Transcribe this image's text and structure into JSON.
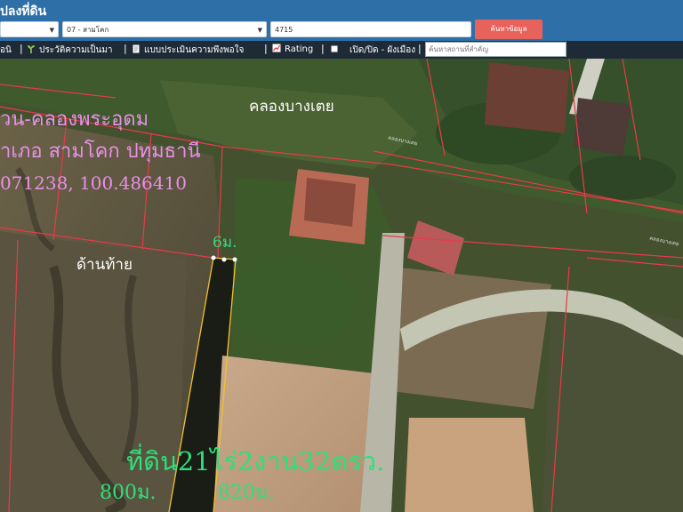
{
  "header": {
    "title": "ปลงที่ดิน",
    "district_select": "07 - สามโคก",
    "parcel_input": "4715",
    "search_button": "ค้นหาข้อมูล"
  },
  "toolbar": {
    "item_first": "อนิ",
    "history": "ประวัติความเป็นมา",
    "survey": "แบบประเมินความพึงพอใจ",
    "rating": "Rating",
    "toggle_plan": "เปิด/ปิด - ผังเมือง",
    "place_placeholder": "ค้นหาสถานที่สำคัญ"
  },
  "map": {
    "location_line1": "วน-คลองพระอุดม",
    "location_line2": "าเภอ สามโคก ปทุมธานี",
    "coordinates": "071238, 100.486410",
    "canal_label": "คลองบางเตย",
    "canal_small_label": "คลองบางเตย",
    "canal_small_label_2": "คลองบางเตย",
    "side_label": "ด้านท้าย",
    "width_label": "6ม.",
    "area_label": "ที่ดิน21ไร่2งาน32ตรว.",
    "left_length": "800ม.",
    "right_length": "820ม."
  },
  "colors": {
    "header_bg": "#2f6fa8",
    "toolbar_bg": "#1f2a37",
    "button_bg": "#e8625c",
    "parcel_line": "#e83a4a",
    "highlight": "#f2c12e",
    "location_text": "#e890e8",
    "measure_text": "#2de07a"
  }
}
